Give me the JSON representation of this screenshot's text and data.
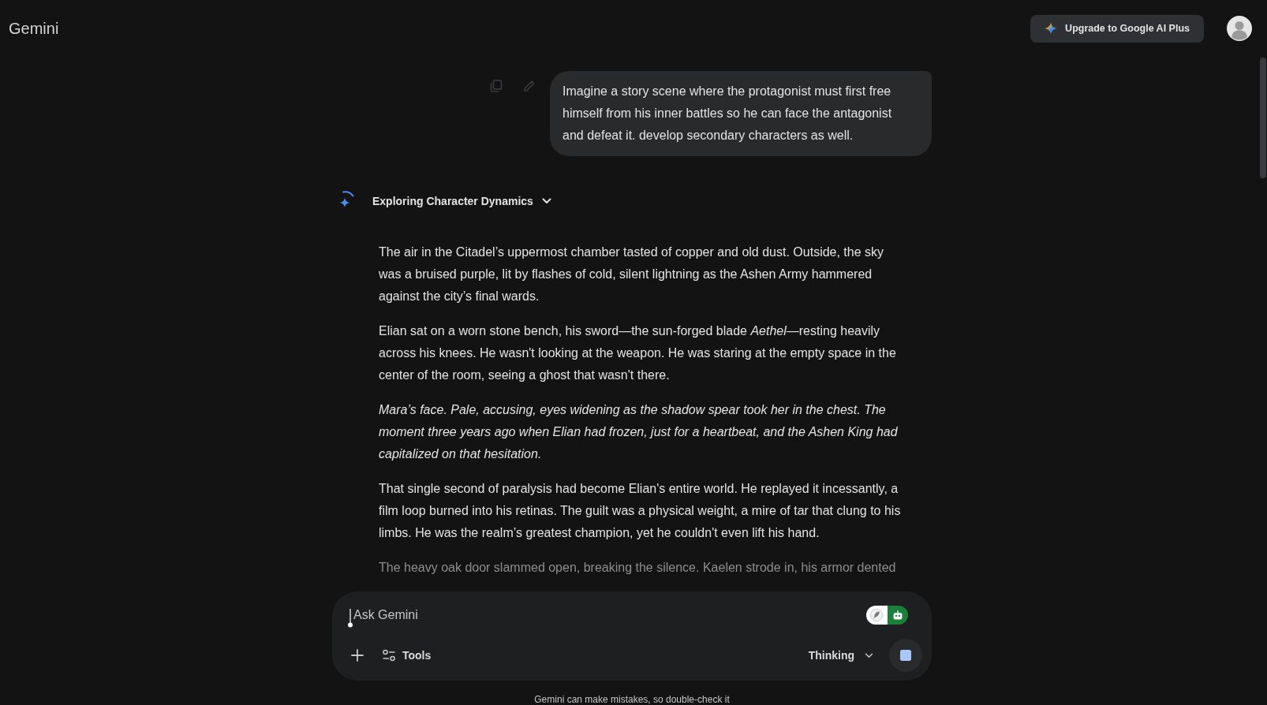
{
  "header": {
    "logo": "Gemini",
    "upgrade_button": "Upgrade to Google AI Plus"
  },
  "conversation": {
    "user_message": "Imagine a story scene where the protagonist must first free himself from his inner battles so he can face the antagonist and defeat it. develop secondary characters as well.",
    "thoughts": {
      "title": "Exploring Character Dynamics",
      "expanded": false
    },
    "paragraphs": [
      {
        "text": "The air in the Citadel’s uppermost chamber tasted of copper and old dust. Outside, the sky was a bruised purple, lit by flashes of cold, silent lightning as the Ashen Army hammered against the city’s final wards.",
        "italic": false,
        "faded": false
      },
      {
        "text": "Elian sat on a worn stone bench, his sword—the sun-forged blade *Aethel*—resting heavily across his knees. He wasn't looking at the weapon. He was staring at the empty space in the center of the room, seeing a ghost that wasn't there.",
        "italic": false,
        "faded": false
      },
      {
        "text": "Mara’s face. Pale, accusing, eyes widening as the shadow spear took her in the chest. The moment three years ago when Elian had frozen, just for a heartbeat, and the Ashen King had capitalized on that hesitation.",
        "italic": true,
        "faded": false
      },
      {
        "text": "That single second of paralysis had become Elian's entire world. He replayed it incessantly, a film loop burned into his retinas. The guilt was a physical weight, a mire of tar that clung to his limbs. He was the realm’s greatest champion, yet he couldn't even lift his hand.",
        "italic": false,
        "faded": false
      },
      {
        "text": "The heavy oak door slammed open, breaking the silence. Kaelen strode in, his armor dented",
        "italic": false,
        "faded": true
      }
    ]
  },
  "composer": {
    "placeholder": "Ask Gemini",
    "tools_label": "Tools",
    "mode": "Thinking"
  },
  "disclaimer": "Gemini can make mistakes, so double-check it"
}
